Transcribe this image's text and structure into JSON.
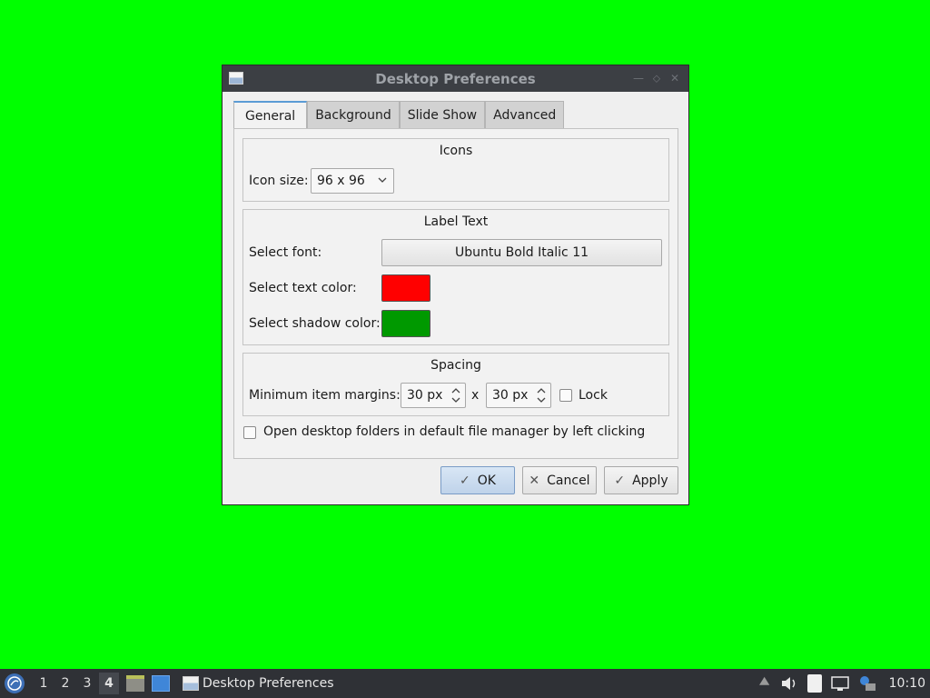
{
  "window": {
    "title": "Desktop Preferences",
    "wm_buttons": [
      "minimize-icon",
      "maximize-icon",
      "close-icon"
    ]
  },
  "tabs": [
    {
      "label": "General",
      "active": true
    },
    {
      "label": "Background",
      "active": false
    },
    {
      "label": "Slide Show",
      "active": false
    },
    {
      "label": "Advanced",
      "active": false
    }
  ],
  "icons_group": {
    "title": "Icons",
    "icon_size_label": "Icon size:",
    "icon_size_value": "96 x 96"
  },
  "label_text_group": {
    "title": "Label Text",
    "font_label": "Select font:",
    "font_value": "Ubuntu Bold Italic 11",
    "text_color_label": "Select text color:",
    "text_color": "#ff0000",
    "shadow_color_label": "Select shadow color:",
    "shadow_color": "#009900"
  },
  "spacing_group": {
    "title": "Spacing",
    "margins_label": "Minimum item margins:",
    "margin_x": "30 px",
    "separator": "x",
    "margin_y": "30 px",
    "lock_label": "Lock",
    "lock_checked": false
  },
  "open_folders": {
    "label": "Open desktop folders in default file manager by left clicking",
    "checked": false
  },
  "buttons": {
    "ok": "OK",
    "cancel": "Cancel",
    "apply": "Apply"
  },
  "taskbar": {
    "workspaces": [
      "1",
      "2",
      "3",
      "4"
    ],
    "active_workspace": "4",
    "task_title": "Desktop Preferences",
    "clock": "10:10"
  },
  "colors": {
    "desktop_background": "#00ff00",
    "titlebar": "#3c3f44",
    "accent": "#5b9bd5",
    "taskbar": "#2f3136"
  }
}
